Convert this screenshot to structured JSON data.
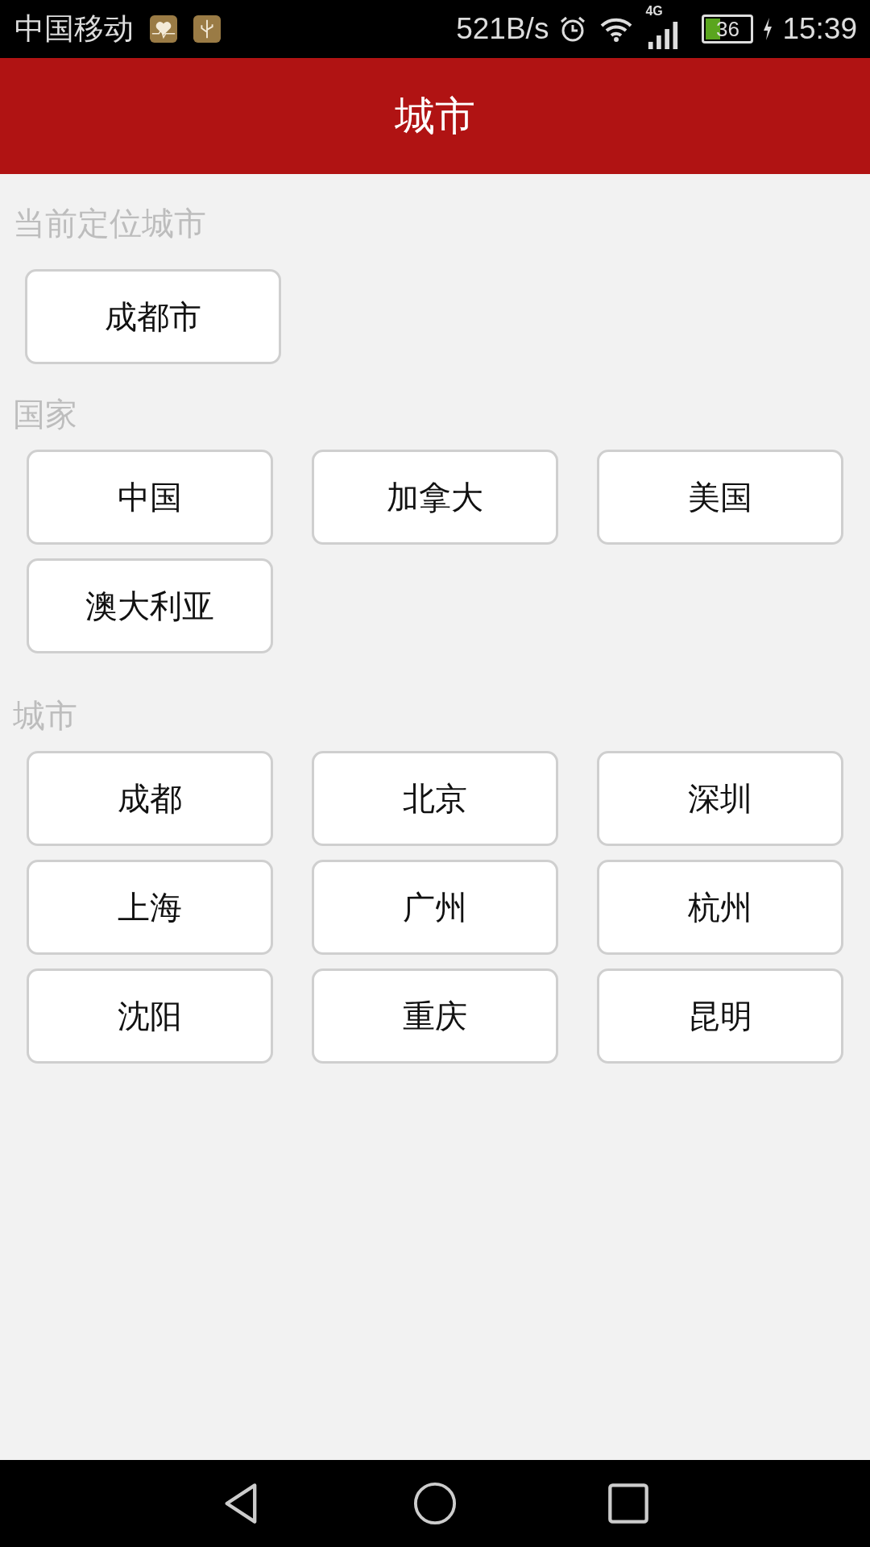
{
  "status_bar": {
    "carrier": "中国移动",
    "speed": "521B/s",
    "network": "4G",
    "battery": "36",
    "time": "15:39"
  },
  "app_bar": {
    "title": "城市"
  },
  "sections": [
    {
      "kind": "location",
      "label": "当前定位城市",
      "items": [
        "成都市"
      ]
    },
    {
      "kind": "grid",
      "label": "国家",
      "items": [
        "中国",
        "加拿大",
        "美国",
        "澳大利亚"
      ]
    },
    {
      "kind": "grid",
      "label": "城市",
      "items": [
        "成都",
        "北京",
        "深圳",
        "上海",
        "广州",
        "杭州",
        "沈阳",
        "重庆",
        "昆明"
      ]
    }
  ]
}
